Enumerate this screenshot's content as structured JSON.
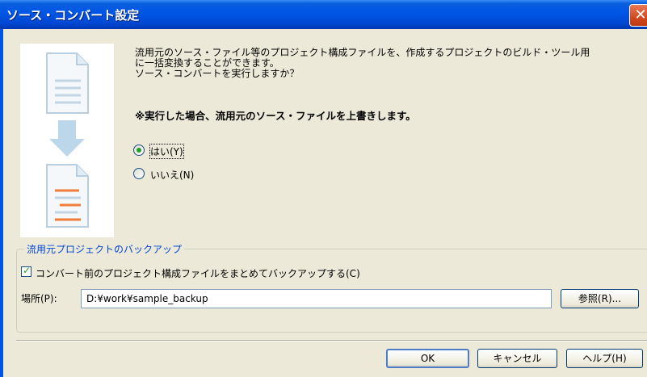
{
  "dialog": {
    "title": "ソース・コンバート設定",
    "close_label": "✕"
  },
  "message": {
    "line1": "流用元のソース・ファイル等のプロジェクト構成ファイルを、作成するプロジェクトのビルド・ツール用",
    "line2": "に一括変換することができます。",
    "line3": "ソース・コンバートを実行しますか？",
    "warning": "※実行した場合、流用元のソース・ファイルを上書きします。"
  },
  "options": {
    "yes_label": "はい(Y)",
    "no_label": "いいえ(N)",
    "selected": "yes"
  },
  "backup": {
    "group_title": "流用元プロジェクトのバックアップ",
    "checkbox_label": "コンバート前のプロジェクト構成ファイルをまとめてバックアップする(C)",
    "checked": true,
    "location_label": "場所(P):",
    "location_value": "D:¥work¥sample_backup",
    "browse_label": "参照(R)..."
  },
  "buttons": {
    "ok": "OK",
    "cancel": "キャンセル",
    "help": "ヘルプ(H)"
  },
  "icons": [
    "document-icon",
    "arrow-down-icon",
    "converted-document-icon"
  ]
}
